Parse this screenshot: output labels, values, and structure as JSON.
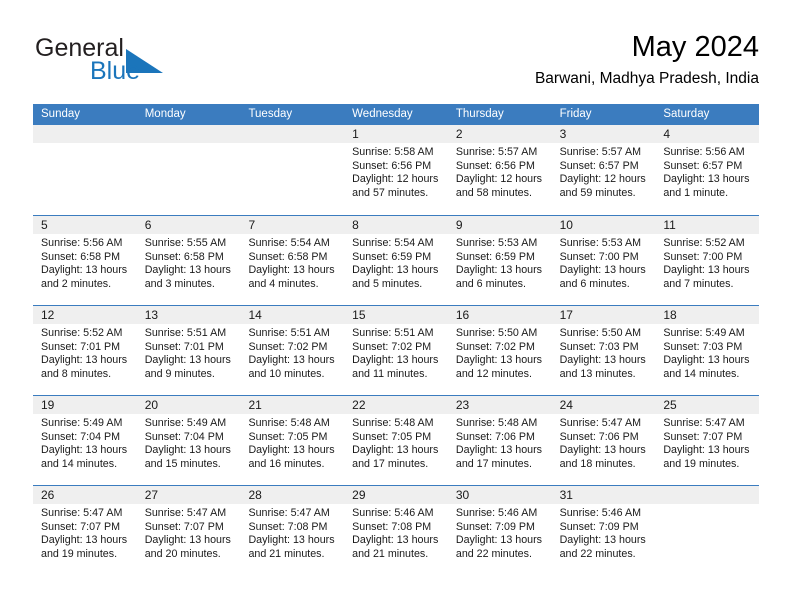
{
  "brand": {
    "name_part1": "General",
    "name_part2": "Blue",
    "flag_icon": "blue-triangle-flag-icon",
    "accent_color": "#1b75bb"
  },
  "header": {
    "title": "May 2024",
    "subtitle": "Barwani, Madhya Pradesh, India"
  },
  "theme": {
    "header_row_bg": "#3b7cbf",
    "day_number_bg": "#efefef",
    "grid_line": "#3b7cbf",
    "text": "#1a1a1a"
  },
  "weekdays": [
    "Sunday",
    "Monday",
    "Tuesday",
    "Wednesday",
    "Thursday",
    "Friday",
    "Saturday"
  ],
  "weeks": [
    [
      {
        "day": "",
        "lines": []
      },
      {
        "day": "",
        "lines": []
      },
      {
        "day": "",
        "lines": []
      },
      {
        "day": "1",
        "lines": [
          "Sunrise: 5:58 AM",
          "Sunset: 6:56 PM",
          "Daylight: 12 hours",
          "and 57 minutes."
        ]
      },
      {
        "day": "2",
        "lines": [
          "Sunrise: 5:57 AM",
          "Sunset: 6:56 PM",
          "Daylight: 12 hours",
          "and 58 minutes."
        ]
      },
      {
        "day": "3",
        "lines": [
          "Sunrise: 5:57 AM",
          "Sunset: 6:57 PM",
          "Daylight: 12 hours",
          "and 59 minutes."
        ]
      },
      {
        "day": "4",
        "lines": [
          "Sunrise: 5:56 AM",
          "Sunset: 6:57 PM",
          "Daylight: 13 hours",
          "and 1 minute."
        ]
      }
    ],
    [
      {
        "day": "5",
        "lines": [
          "Sunrise: 5:56 AM",
          "Sunset: 6:58 PM",
          "Daylight: 13 hours",
          "and 2 minutes."
        ]
      },
      {
        "day": "6",
        "lines": [
          "Sunrise: 5:55 AM",
          "Sunset: 6:58 PM",
          "Daylight: 13 hours",
          "and 3 minutes."
        ]
      },
      {
        "day": "7",
        "lines": [
          "Sunrise: 5:54 AM",
          "Sunset: 6:58 PM",
          "Daylight: 13 hours",
          "and 4 minutes."
        ]
      },
      {
        "day": "8",
        "lines": [
          "Sunrise: 5:54 AM",
          "Sunset: 6:59 PM",
          "Daylight: 13 hours",
          "and 5 minutes."
        ]
      },
      {
        "day": "9",
        "lines": [
          "Sunrise: 5:53 AM",
          "Sunset: 6:59 PM",
          "Daylight: 13 hours",
          "and 6 minutes."
        ]
      },
      {
        "day": "10",
        "lines": [
          "Sunrise: 5:53 AM",
          "Sunset: 7:00 PM",
          "Daylight: 13 hours",
          "and 6 minutes."
        ]
      },
      {
        "day": "11",
        "lines": [
          "Sunrise: 5:52 AM",
          "Sunset: 7:00 PM",
          "Daylight: 13 hours",
          "and 7 minutes."
        ]
      }
    ],
    [
      {
        "day": "12",
        "lines": [
          "Sunrise: 5:52 AM",
          "Sunset: 7:01 PM",
          "Daylight: 13 hours",
          "and 8 minutes."
        ]
      },
      {
        "day": "13",
        "lines": [
          "Sunrise: 5:51 AM",
          "Sunset: 7:01 PM",
          "Daylight: 13 hours",
          "and 9 minutes."
        ]
      },
      {
        "day": "14",
        "lines": [
          "Sunrise: 5:51 AM",
          "Sunset: 7:02 PM",
          "Daylight: 13 hours",
          "and 10 minutes."
        ]
      },
      {
        "day": "15",
        "lines": [
          "Sunrise: 5:51 AM",
          "Sunset: 7:02 PM",
          "Daylight: 13 hours",
          "and 11 minutes."
        ]
      },
      {
        "day": "16",
        "lines": [
          "Sunrise: 5:50 AM",
          "Sunset: 7:02 PM",
          "Daylight: 13 hours",
          "and 12 minutes."
        ]
      },
      {
        "day": "17",
        "lines": [
          "Sunrise: 5:50 AM",
          "Sunset: 7:03 PM",
          "Daylight: 13 hours",
          "and 13 minutes."
        ]
      },
      {
        "day": "18",
        "lines": [
          "Sunrise: 5:49 AM",
          "Sunset: 7:03 PM",
          "Daylight: 13 hours",
          "and 14 minutes."
        ]
      }
    ],
    [
      {
        "day": "19",
        "lines": [
          "Sunrise: 5:49 AM",
          "Sunset: 7:04 PM",
          "Daylight: 13 hours",
          "and 14 minutes."
        ]
      },
      {
        "day": "20",
        "lines": [
          "Sunrise: 5:49 AM",
          "Sunset: 7:04 PM",
          "Daylight: 13 hours",
          "and 15 minutes."
        ]
      },
      {
        "day": "21",
        "lines": [
          "Sunrise: 5:48 AM",
          "Sunset: 7:05 PM",
          "Daylight: 13 hours",
          "and 16 minutes."
        ]
      },
      {
        "day": "22",
        "lines": [
          "Sunrise: 5:48 AM",
          "Sunset: 7:05 PM",
          "Daylight: 13 hours",
          "and 17 minutes."
        ]
      },
      {
        "day": "23",
        "lines": [
          "Sunrise: 5:48 AM",
          "Sunset: 7:06 PM",
          "Daylight: 13 hours",
          "and 17 minutes."
        ]
      },
      {
        "day": "24",
        "lines": [
          "Sunrise: 5:47 AM",
          "Sunset: 7:06 PM",
          "Daylight: 13 hours",
          "and 18 minutes."
        ]
      },
      {
        "day": "25",
        "lines": [
          "Sunrise: 5:47 AM",
          "Sunset: 7:07 PM",
          "Daylight: 13 hours",
          "and 19 minutes."
        ]
      }
    ],
    [
      {
        "day": "26",
        "lines": [
          "Sunrise: 5:47 AM",
          "Sunset: 7:07 PM",
          "Daylight: 13 hours",
          "and 19 minutes."
        ]
      },
      {
        "day": "27",
        "lines": [
          "Sunrise: 5:47 AM",
          "Sunset: 7:07 PM",
          "Daylight: 13 hours",
          "and 20 minutes."
        ]
      },
      {
        "day": "28",
        "lines": [
          "Sunrise: 5:47 AM",
          "Sunset: 7:08 PM",
          "Daylight: 13 hours",
          "and 21 minutes."
        ]
      },
      {
        "day": "29",
        "lines": [
          "Sunrise: 5:46 AM",
          "Sunset: 7:08 PM",
          "Daylight: 13 hours",
          "and 21 minutes."
        ]
      },
      {
        "day": "30",
        "lines": [
          "Sunrise: 5:46 AM",
          "Sunset: 7:09 PM",
          "Daylight: 13 hours",
          "and 22 minutes."
        ]
      },
      {
        "day": "31",
        "lines": [
          "Sunrise: 5:46 AM",
          "Sunset: 7:09 PM",
          "Daylight: 13 hours",
          "and 22 minutes."
        ]
      },
      {
        "day": "",
        "lines": []
      }
    ]
  ]
}
